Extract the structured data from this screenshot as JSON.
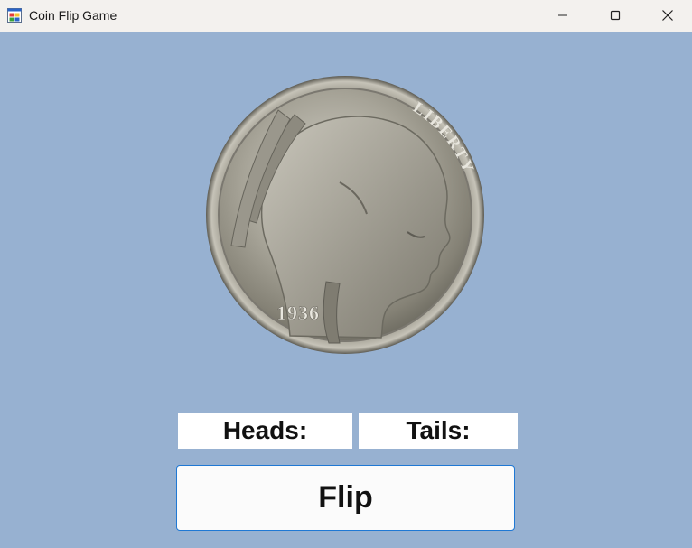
{
  "window": {
    "title": "Coin Flip Game",
    "app_icon": "windows-forms-app-icon",
    "controls": [
      "minimize-icon",
      "maximize-icon",
      "close-icon"
    ]
  },
  "coin": {
    "icon": "buffalo-nickel-coin-image",
    "inscription": "LIBERTY",
    "year": "1936"
  },
  "scores": {
    "heads_label": "Heads:",
    "tails_label": "Tails:"
  },
  "actions": {
    "flip_label": "Flip"
  },
  "colors": {
    "background": "#97b1d1",
    "titlebar": "#f3f1ee",
    "button_border": "#1f78d4"
  }
}
